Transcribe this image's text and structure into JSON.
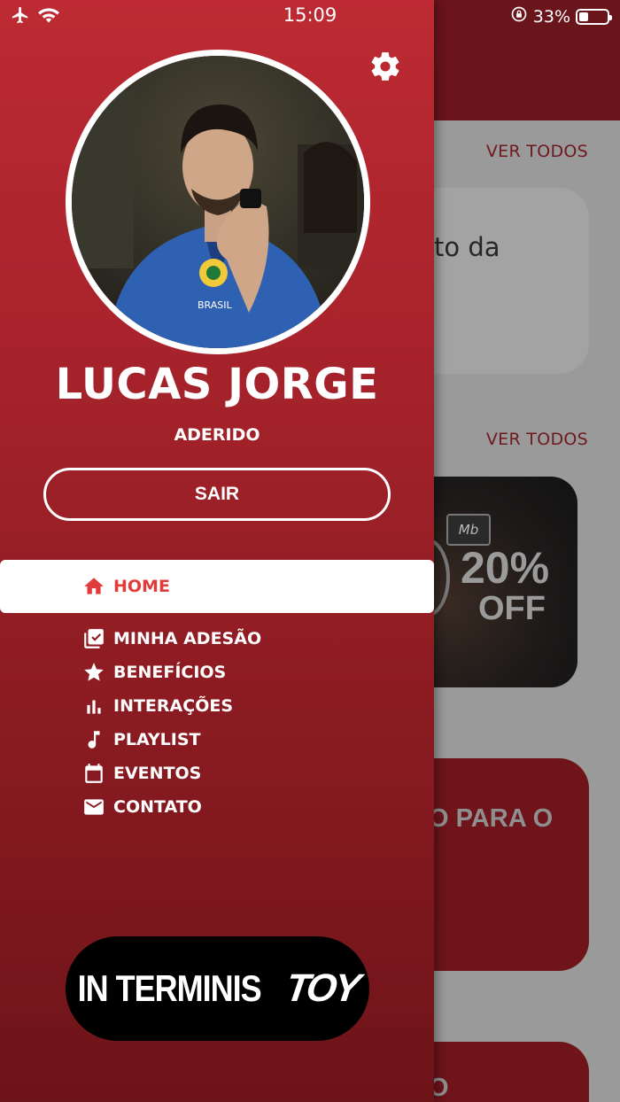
{
  "status_bar": {
    "time": "15:09",
    "battery_text": "33%",
    "battery_level": 0.33,
    "icons": [
      "airplane-icon",
      "wifi-icon",
      "rotation-lock-icon",
      "battery-icon"
    ]
  },
  "background": {
    "see_all_1": "VER TODOS",
    "see_all_2": "VER TODOS",
    "card1_text": "to da",
    "promo_percent": "20%",
    "promo_off": "OFF",
    "promo_logo": "Mb",
    "card3_text": "O PARA O",
    "card4_text": "O"
  },
  "drawer": {
    "settings_icon": "gear-icon",
    "profile": {
      "name": "LUCAS JORGE",
      "status": "ADERIDO"
    },
    "logout_label": "SAIR",
    "menu": [
      {
        "label": "HOME",
        "icon": "home-icon",
        "active": true
      },
      {
        "label": "MINHA ADESÃO",
        "icon": "checklist-icon",
        "active": false
      },
      {
        "label": "BENEFÍCIOS",
        "icon": "star-icon",
        "active": false
      },
      {
        "label": "INTERAÇÕES",
        "icon": "bar-chart-icon",
        "active": false
      },
      {
        "label": "PLAYLIST",
        "icon": "music-note-icon",
        "active": false
      },
      {
        "label": "EVENTOS",
        "icon": "calendar-icon",
        "active": false
      },
      {
        "label": "CONTATO",
        "icon": "mail-icon",
        "active": false
      }
    ],
    "brand": {
      "left": "IN TERMINIS",
      "right": "TOY"
    }
  },
  "colors": {
    "drawer_top": "#bd2a33",
    "drawer_bottom": "#6d1419",
    "active_text": "#e23b3b"
  }
}
